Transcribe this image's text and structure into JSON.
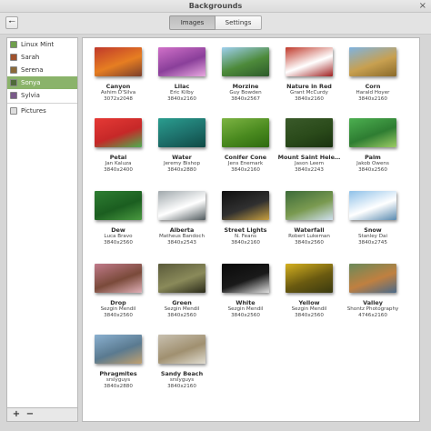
{
  "window": {
    "title": "Backgrounds"
  },
  "toolbar": {
    "back_icon": "left-arrow-icon",
    "back_glyph": "🠐"
  },
  "tabs": [
    {
      "label": "Images",
      "active": true
    },
    {
      "label": "Settings",
      "active": false
    }
  ],
  "sidebar": {
    "items": [
      {
        "label": "Linux Mint",
        "thumb_color": "#6f9f4c",
        "selected": false
      },
      {
        "label": "Sarah",
        "thumb_color": "#a0522d",
        "selected": false
      },
      {
        "label": "Serena",
        "thumb_color": "#8b6a3a",
        "selected": false
      },
      {
        "label": "Sonya",
        "thumb_color": "#4f6b3a",
        "selected": true
      },
      {
        "label": "Sylvia",
        "thumb_color": "#7a5a8a",
        "selected": false
      }
    ],
    "pictures": {
      "label": "Pictures",
      "thumb_color": "#dddddd"
    },
    "add_glyph": "+",
    "remove_glyph": "−"
  },
  "accent_color": "#8ab36a",
  "backgrounds": [
    {
      "name": "Canyon",
      "author": "Ashim D'Silva",
      "res": "3072x2048",
      "colors": [
        "#c0392b",
        "#e67e22",
        "#7b3f2b"
      ]
    },
    {
      "name": "Lilac",
      "author": "Eric Kilby",
      "res": "3840x2160",
      "colors": [
        "#d070c8",
        "#8a3f9a",
        "#e8a8e0"
      ]
    },
    {
      "name": "Morzine",
      "author": "Guy Bowden",
      "res": "3840x2567",
      "colors": [
        "#9fd0ef",
        "#4d8a3a",
        "#2c5a2a"
      ]
    },
    {
      "name": "Nature in Red",
      "author": "Grant McCurdy",
      "res": "3840x2160",
      "colors": [
        "#c0392b",
        "#ffffff",
        "#a02020"
      ]
    },
    {
      "name": "Corn",
      "author": "Harald Hoyer",
      "res": "3840x2160",
      "colors": [
        "#7fb3e0",
        "#c8a050",
        "#8a6a2a"
      ]
    },
    {
      "name": "Petal",
      "author": "Jan Kaluza",
      "res": "3840x2400",
      "colors": [
        "#e53935",
        "#c62828",
        "#4caf50"
      ]
    },
    {
      "name": "Water",
      "author": "Jeremy Bishop",
      "res": "3840x2880",
      "colors": [
        "#2a9d8f",
        "#1d6f6a",
        "#0f4a45"
      ]
    },
    {
      "name": "Conifer Cone",
      "author": "Jens Enemark",
      "res": "3840x2160",
      "colors": [
        "#7cb342",
        "#4a8a1f",
        "#2e6a10"
      ]
    },
    {
      "name": "Mount Saint Hele…",
      "author": "Jason Leem",
      "res": "3840x2243",
      "colors": [
        "#3a5a2a",
        "#2a4a1a",
        "#1a3210"
      ]
    },
    {
      "name": "Palm",
      "author": "Jakob Owens",
      "res": "3840x2560",
      "colors": [
        "#4caf50",
        "#2e7d32",
        "#9ccc65"
      ]
    },
    {
      "name": "Dew",
      "author": "Luca Bravo",
      "res": "3840x2560",
      "colors": [
        "#2e7d32",
        "#1b5e20",
        "#4a9a40"
      ]
    },
    {
      "name": "Alberta",
      "author": "Matheus Bandoch",
      "res": "3840x2543",
      "colors": [
        "#a0a8ac",
        "#ffffff",
        "#505a5e"
      ]
    },
    {
      "name": "Street Lights",
      "author": "N. Feans",
      "res": "3840x2160",
      "colors": [
        "#101010",
        "#303030",
        "#c8a040"
      ]
    },
    {
      "name": "Waterfall",
      "author": "Robert Lukeman",
      "res": "3840x2560",
      "colors": [
        "#3d6b3a",
        "#7a9a50",
        "#cfe0ef"
      ]
    },
    {
      "name": "Snow",
      "author": "Stanley Dai",
      "res": "3840x2745",
      "colors": [
        "#8fc1e8",
        "#ffffff",
        "#5a8ab0"
      ]
    },
    {
      "name": "Drop",
      "author": "Sezgin Mendil",
      "res": "3840x2560",
      "colors": [
        "#c07a8a",
        "#7a4a3a",
        "#e0b0b8"
      ]
    },
    {
      "name": "Green",
      "author": "Sezgin Mendil",
      "res": "3840x2560",
      "colors": [
        "#5a5a3a",
        "#8a8a5a",
        "#2a2a1a"
      ]
    },
    {
      "name": "White",
      "author": "Sezgin Mendil",
      "res": "3840x2560",
      "colors": [
        "#0a0a0a",
        "#1a1a1a",
        "#e0e0e0"
      ]
    },
    {
      "name": "Yellow",
      "author": "Sezgin Mendil",
      "res": "3840x2560",
      "colors": [
        "#d4b020",
        "#6a5a10",
        "#3a3a10"
      ]
    },
    {
      "name": "Valley",
      "author": "Shontz Photography",
      "res": "4746x2160",
      "colors": [
        "#6a8a5a",
        "#c08040",
        "#4a6a8a"
      ]
    },
    {
      "name": "Phragmites",
      "author": "srslyguys",
      "res": "3840x2880",
      "colors": [
        "#8ab0d0",
        "#5a7a90",
        "#c0a070"
      ]
    },
    {
      "name": "Sandy Beach",
      "author": "srslyguys",
      "res": "3840x2160",
      "colors": [
        "#c8c0b0",
        "#a09070",
        "#e0dcd0"
      ]
    }
  ]
}
